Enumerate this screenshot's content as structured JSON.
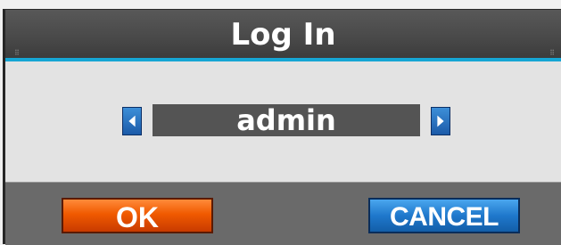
{
  "dialog": {
    "title": "Log In",
    "user_selector": {
      "value": "admin",
      "prev_icon": "arrow-left-icon",
      "next_icon": "arrow-right-icon"
    },
    "buttons": {
      "ok_label": "OK",
      "cancel_label": "CANCEL"
    }
  },
  "colors": {
    "title_underline": "#16a6d4",
    "ok_button": "#f05a00",
    "cancel_button": "#1f78cc",
    "value_box": "#545454"
  }
}
